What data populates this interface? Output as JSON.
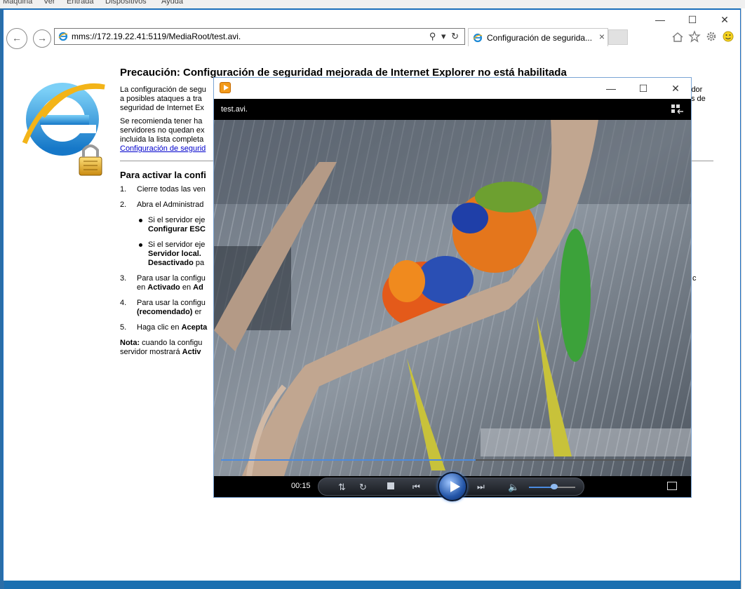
{
  "vm_menu": [
    "Máquina",
    "Ver",
    "Entrada",
    "Dispositivos",
    "Ayuda"
  ],
  "browser": {
    "address": "mms://172.19.22.41:5119/MediaRoot/test.avi.",
    "tab_label": "Configuración de segurida...",
    "tab_close": "×",
    "caption_minimize": "—",
    "caption_maximize": "☐",
    "caption_close": "✕",
    "back": "←",
    "forward": "→",
    "address_tools": "⚲ ▾ ↻",
    "toolbar_icons": [
      "home-icon",
      "favorites-icon",
      "settings-icon",
      "smiley-icon"
    ]
  },
  "page": {
    "title": "Precaución: Configuración de seguridad mejorada de Internet Explorer no está habilitada",
    "para1_start": "La configuración de segu",
    "para1_end": "idor",
    "para1_line2": "a posibles ataques a tra",
    "para1_line2_end": "s de",
    "para1_line3": "seguridad de Internet Ex",
    "para2_line1": "Se recomienda tener ha",
    "para2_line2": "servidores no quedan ex",
    "para2_line3": "incluida la lista completa",
    "link": "Configuración de segurid",
    "subhead": "Para activar la confi",
    "steps": [
      {
        "num": "1.",
        "text": "Cierre todas las ven"
      },
      {
        "num": "2.",
        "text": "Abra el Administrad"
      }
    ],
    "bullets": [
      {
        "line1": "Si el servidor eje",
        "line2_bold": "Configurar ESC"
      },
      {
        "line1": "Si el servidor eje",
        "line2_bold": "Servidor local.",
        "line3_bold": "Desactivado",
        "line3_rest": " pa"
      }
    ],
    "steps2": [
      {
        "num": "3.",
        "line1": "Para usar la configu",
        "line1_end": "c",
        "line2_bold1": "en ",
        "line2_a": "Activado",
        "line2_b": " en ",
        "line2_c": "Ad"
      },
      {
        "num": "4.",
        "line1": "Para usar la configu",
        "line2_bold": "(recomendado)",
        "line2_rest": " er"
      },
      {
        "num": "5.",
        "text": "Haga clic en ",
        "bold": "Acepta"
      }
    ],
    "note_label": "Nota:",
    "note_text": " cuando la configu",
    "note_line2": "servidor mostrará ",
    "note_line2_bold": "Activ"
  },
  "player": {
    "filename": "test.avi.",
    "time": "00:15",
    "caption_minimize": "—",
    "caption_maximize": "☐",
    "caption_close": "✕",
    "seek_progress": 0.55,
    "volume_level": 0.55
  }
}
